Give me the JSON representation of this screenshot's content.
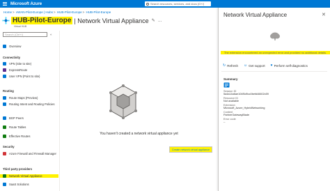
{
  "topbar": {
    "brand": "Microsoft Azure",
    "search_placeholder": "Search resources, services, and docs (G+/)"
  },
  "breadcrumb": [
    "Home",
    "vWAN-Pilot-Europe | Hubs",
    "HUB-Pilot-Europe",
    "HUB-Pilot-Europe"
  ],
  "header": {
    "title_highlight": "HUB-Pilot-Europe",
    "title_rest": "| Network Virtual Appliance",
    "subtitle": "Virtual HUB"
  },
  "sidebar": {
    "search_placeholder": "Search (Ctrl+/)",
    "collapse": "«",
    "items": [
      {
        "label": "Overview",
        "icon": "overview-icon",
        "color": "#0078d4"
      },
      {
        "section": "Connectivity"
      },
      {
        "label": "VPN (Site to site)",
        "icon": "vpn-icon",
        "color": "#0078d4"
      },
      {
        "label": "ExpressRoute",
        "icon": "expressroute-icon",
        "color": "#5c2d91"
      },
      {
        "label": "User VPN (Point to site)",
        "icon": "user-vpn-icon",
        "color": "#0078d4"
      },
      {
        "section": "Routing"
      },
      {
        "label": "Route Maps (Preview)",
        "icon": "route-maps-icon",
        "color": "#0078d4"
      },
      {
        "label": "Routing Intent and Routing Policies",
        "icon": "routing-intent-icon",
        "color": "#0078d4"
      },
      {
        "label": "BGP Peers",
        "icon": "bgp-icon",
        "color": "#0078d4"
      },
      {
        "label": "Route Tables",
        "icon": "route-tables-icon",
        "color": "#107c10"
      },
      {
        "label": "Effective Routes",
        "icon": "effective-routes-icon",
        "color": "#107c10"
      },
      {
        "section": "Security"
      },
      {
        "label": "Azure Firewall and Firewall Manager",
        "icon": "firewall-icon",
        "color": "#d13438"
      },
      {
        "section": "Third party providers"
      },
      {
        "label": "Network Virtual Appliance",
        "icon": "nva-icon",
        "color": "#107c10"
      },
      {
        "label": "SaaS Solutions",
        "icon": "saas-icon",
        "color": "#0078d4"
      }
    ]
  },
  "main": {
    "empty_text": "You haven't created a network virtual appliance yet",
    "create_button": "Create network virtual appliance"
  },
  "panel": {
    "title": "Network Virtual Appliance",
    "close": "✕",
    "warning": "The extension encountered an unexpected error and provided no additional details.",
    "actions": {
      "refresh": "Refresh",
      "support": "Get support",
      "diagnostics": "Perform self-diagnostics"
    },
    "summary_title": "Summary",
    "fields": [
      {
        "key": "Session ID",
        "value": "5a4a14a6ae104f5d9cc0befd46602c59"
      },
      {
        "key": "Resource ID",
        "value": "Not available"
      },
      {
        "key": "Extension",
        "value": "Microsoft_Azure_HybridNetworking"
      },
      {
        "key": "Content",
        "value": "PartnerGatewayBlade"
      },
      {
        "key": "Error code",
        "value": "--"
      }
    ]
  }
}
